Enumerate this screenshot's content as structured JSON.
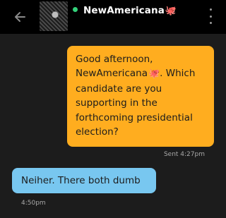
{
  "header": {
    "contact_name": "NewAmericana",
    "contact_emoji": "🐙",
    "online": true,
    "back_icon": "arrow-left-icon",
    "menu_icon": "more-vertical-icon"
  },
  "messages": [
    {
      "direction": "sent",
      "lines": [
        "Good afternoon,",
        "NewAmericana",
        ". Which",
        "candidate are you",
        "supporting in the",
        "forthcoming presidential",
        "election?"
      ],
      "emoji": "🐙",
      "meta": "Sent 4:27pm"
    },
    {
      "direction": "received",
      "text": "Neiher. There both dumb",
      "meta": "4:50pm"
    }
  ],
  "colors": {
    "background": "#1c1c1c",
    "topbar": "#000000",
    "sent_bubble": "#ffad1f",
    "received_bubble": "#78c7f0",
    "online_dot": "#33d17a"
  }
}
